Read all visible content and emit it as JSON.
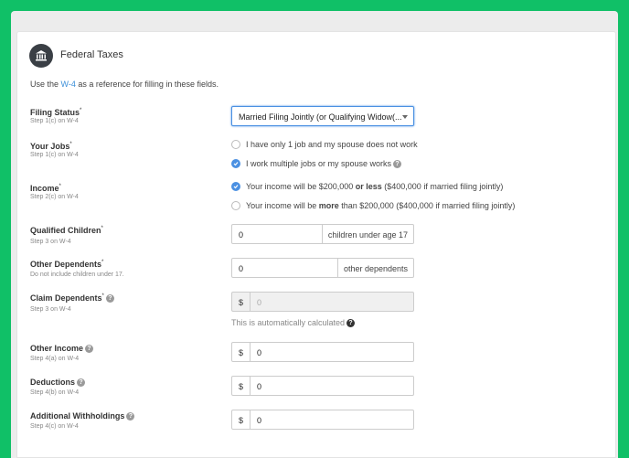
{
  "header": {
    "title": "Federal Taxes",
    "icon": "bank-icon"
  },
  "intro": {
    "prefix": "Use the ",
    "link": "W-4",
    "suffix": " as a reference for filling in these fields."
  },
  "filing_status": {
    "label": "Filing Status",
    "mark": "*",
    "sub": "Step 1(c) on W-4",
    "selected": "Married Filing Jointly (or Qualifying Widow(..."
  },
  "jobs": {
    "label": "Your Jobs",
    "mark": "*",
    "sub": "Step 1(c) on W-4",
    "option1": "I have only 1 job and my spouse does not work",
    "option2": "I work multiple jobs or my spouse works"
  },
  "income": {
    "label": "Income",
    "mark": "*",
    "sub": "Step 2(c) on W-4",
    "option1_a": "Your income will be $200,000 ",
    "option1_b": "or less",
    "option1_c": " ($400,000 if married filing jointly)",
    "option2_a": "Your income will be ",
    "option2_b": "more",
    "option2_c": " than $200,000 ($400,000 if married filing jointly)"
  },
  "children": {
    "label": "Qualified Children",
    "mark": "*",
    "sub": "Step 3 on W-4",
    "value": "0",
    "addon": "children under age 17"
  },
  "dependents": {
    "label": "Other Dependents",
    "mark": "*",
    "sub": "Do not include children under 17.",
    "value": "0",
    "addon": "other dependents"
  },
  "claim": {
    "label": "Claim Dependents",
    "mark": "*",
    "sub": "Step 3 on W-4",
    "prefix": "$",
    "value": "0",
    "note": "This is automatically calculated"
  },
  "other_income": {
    "label": "Other Income",
    "sub": "Step 4(a) on W-4",
    "prefix": "$",
    "value": "0"
  },
  "deductions": {
    "label": "Deductions",
    "sub": "Step 4(b) on W-4",
    "prefix": "$",
    "value": "0"
  },
  "withholdings": {
    "label": "Additional Withholdings",
    "sub": "Step 4(c) on W-4",
    "prefix": "$",
    "value": "0"
  },
  "colors": {
    "accent": "#4a90e2",
    "background": "#10c067",
    "link": "#3b8fd9"
  }
}
